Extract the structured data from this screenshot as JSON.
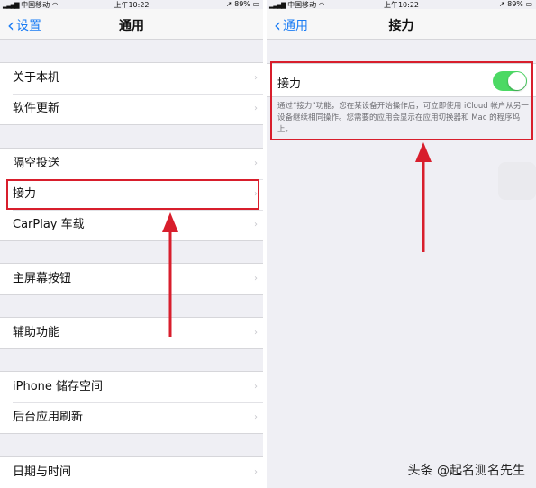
{
  "left": {
    "status": {
      "carrier": "中国移动",
      "time": "上午10:22",
      "battery": "89%"
    },
    "nav": {
      "back_label": "设置",
      "title": "通用"
    },
    "groups": [
      [
        "关于本机",
        "软件更新"
      ],
      [
        "隔空投送",
        "接力",
        "CarPlay 车载"
      ],
      [
        "主屏幕按钮"
      ],
      [
        "辅助功能"
      ],
      [
        "iPhone 储存空间",
        "后台应用刷新"
      ],
      [
        "日期与时间"
      ]
    ],
    "highlighted_item": "接力"
  },
  "right": {
    "status": {
      "carrier": "中国移动",
      "time": "上午10:22",
      "battery": "89%"
    },
    "nav": {
      "back_label": "通用",
      "title": "接力"
    },
    "handoff": {
      "label": "接力",
      "toggle_on": true,
      "description": "通过“接力”功能，您在某设备开始操作后，可立即使用 iCloud 帐户从另一设备继续相同操作。您需要的应用会显示在应用切换器和 Mac 的程序坞上。"
    }
  },
  "watermark": "头条 @起名测名先生",
  "colors": {
    "accent": "#1a7cf4",
    "toggle_on": "#4cd964",
    "highlight": "#d81e2c",
    "background": "#efeff4"
  },
  "icons": [
    "signal-icon",
    "wifi-icon",
    "location-icon",
    "battery-icon",
    "chevron-left-icon",
    "chevron-right-icon",
    "red-arrow-icon"
  ]
}
